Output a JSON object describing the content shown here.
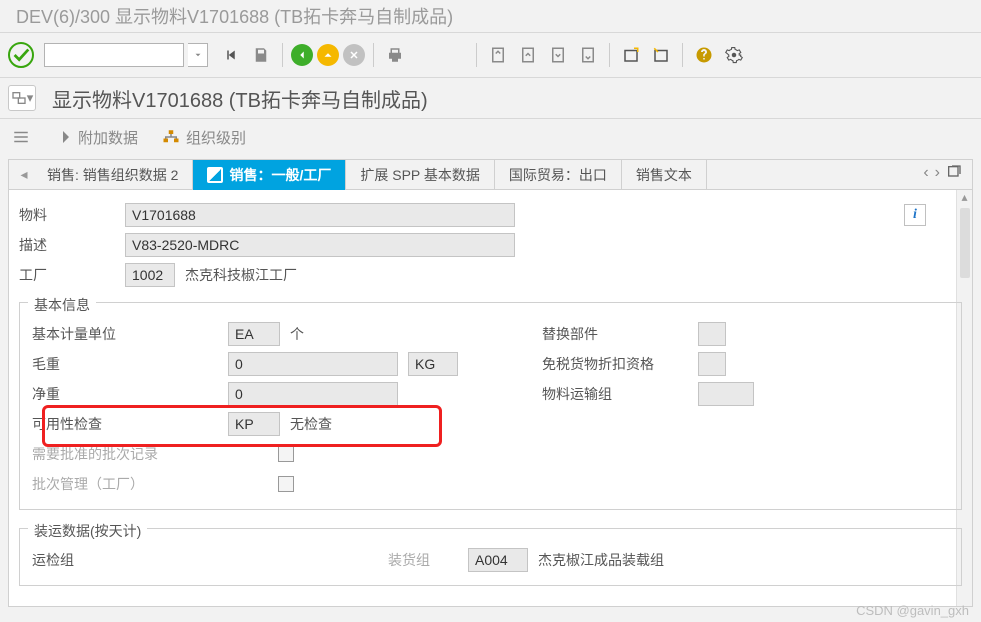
{
  "window": {
    "title": "DEV(6)/300 显示物料V1701688 (TB拓卡奔马自制成品)"
  },
  "subheader": {
    "title": "显示物料V1701688 (TB拓卡奔马自制成品)"
  },
  "links": {
    "extraData": "附加数据",
    "orgLevels": "组织级别"
  },
  "tabs": {
    "t0": "销售: 销售组织数据 2",
    "t1": "销售：一般/工厂",
    "t2": "扩展 SPP 基本数据",
    "t3": "国际贸易：出口",
    "t4": "销售文本"
  },
  "header": {
    "materialLabel": "物料",
    "materialValue": "V1701688",
    "descLabel": "描述",
    "descValue": "V83-2520-MDRC",
    "plantLabel": "工厂",
    "plantValue": "1002",
    "plantName": "杰克科技椒江工厂"
  },
  "basic": {
    "title": "基本信息",
    "uomLabel": "基本计量单位",
    "uomValue": "EA",
    "uomText": "个",
    "grossWeightLabel": "毛重",
    "grossWeightValue": "0",
    "weightUnit": "KG",
    "netWeightLabel": "净重",
    "netWeightValue": "0",
    "availCheckLabel": "可用性检查",
    "availCheckValue": "KP",
    "availCheckText": "无检查",
    "batchReqLabel": "需要批准的批次记录",
    "batchMgmtLabel": "批次管理（工厂）",
    "replacePartLabel": "替换部件",
    "dutyFreeLabel": "免税货物折扣资格",
    "transGroupLabel": "物料运输组"
  },
  "ship": {
    "title": "装运数据(按天计)",
    "leftLabel": "运检组",
    "midLabel": "装货组",
    "midValue": "A004",
    "rightText": "杰克椒江成品装载组"
  },
  "watermark": "CSDN @gavin_gxh"
}
